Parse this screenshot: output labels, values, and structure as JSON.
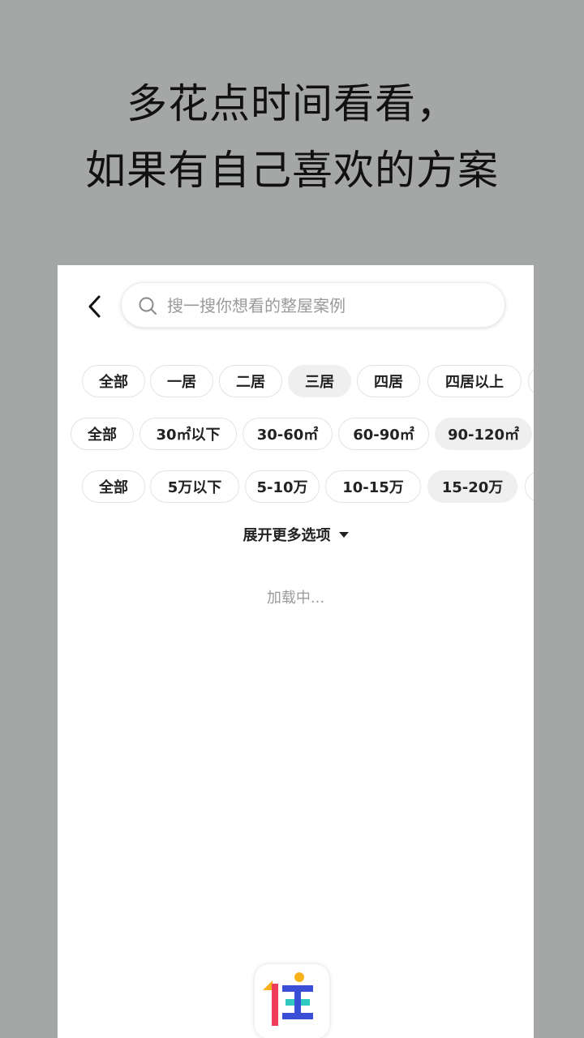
{
  "caption": {
    "line1": "多花点时间看看，",
    "line2": "如果有自己喜欢的方案"
  },
  "search": {
    "placeholder": "搜一搜你想看的整屋案例",
    "value": ""
  },
  "icons": {
    "back": "chevron-left-icon",
    "search": "search-icon",
    "expand": "caret-down-icon",
    "logo": "app-logo-icon"
  },
  "filters": {
    "rooms": [
      {
        "label": "全部",
        "selected": false
      },
      {
        "label": "一居",
        "selected": false
      },
      {
        "label": "二居",
        "selected": false
      },
      {
        "label": "三居",
        "selected": true
      },
      {
        "label": "四居",
        "selected": false
      },
      {
        "label": "四居以上",
        "selected": false
      }
    ],
    "area": [
      {
        "label": "全部",
        "selected": false
      },
      {
        "label": "30㎡以下",
        "selected": false
      },
      {
        "label": "30-60㎡",
        "selected": false
      },
      {
        "label": "60-90㎡",
        "selected": false
      },
      {
        "label": "90-120㎡",
        "selected": true
      }
    ],
    "budget": [
      {
        "label": "全部",
        "selected": false
      },
      {
        "label": "5万以下",
        "selected": false
      },
      {
        "label": "5-10万",
        "selected": false
      },
      {
        "label": "10-15万",
        "selected": false
      },
      {
        "label": "15-20万",
        "selected": true
      }
    ]
  },
  "expand_label": "展开更多选项",
  "loading_text": "加载中...",
  "colors": {
    "background": "#a5a6a6",
    "selected_chip": "#efefef",
    "logo_orange": "#f7b21a",
    "logo_red": "#ee3f5a",
    "logo_blue": "#3b4fd6",
    "logo_teal": "#2fc9c0"
  }
}
